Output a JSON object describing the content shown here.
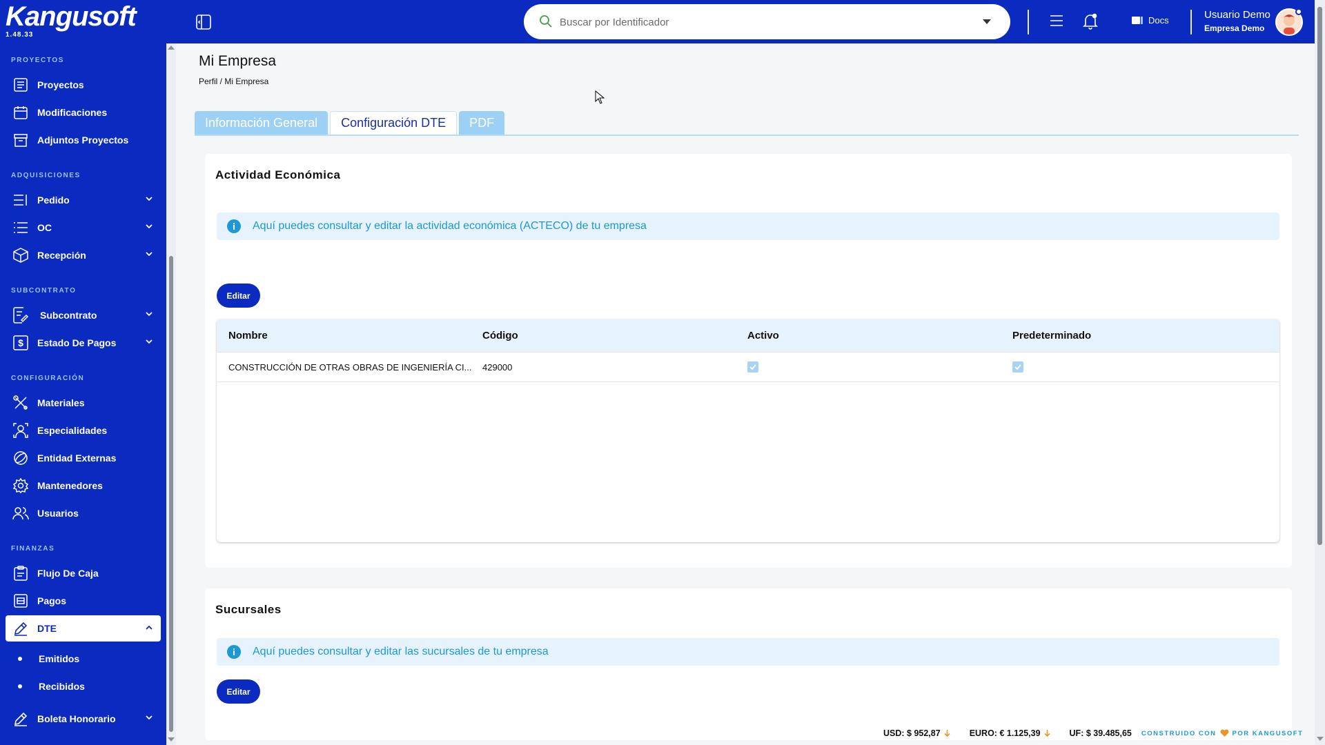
{
  "brand": {
    "name": "Kangusoft",
    "version": "1.48.33"
  },
  "header": {
    "search_placeholder": "Buscar por Identificador",
    "docs_label": "Docs",
    "user_name": "Usuario Demo",
    "company": "Empresa Demo"
  },
  "sidebar": {
    "sections": {
      "proyectos": "PROYECTOS",
      "adquisiciones": "ADQUISICIONES",
      "subcontrato": "SUBCONTRATO",
      "configuracion": "CONFIGURACIÓN",
      "finanzas": "FINANZAS"
    },
    "items": {
      "proyectos": "Proyectos",
      "modificaciones": "Modificaciones",
      "adjuntos": "Adjuntos Proyectos",
      "pedido": "Pedido",
      "oc": "OC",
      "recepcion": "Recepción",
      "subcontrato": "Subcontrato",
      "estado_pagos": "Estado De Pagos",
      "materiales": "Materiales",
      "especialidades": "Especialidades",
      "entidad_externas": "Entidad Externas",
      "mantenedores": "Mantenedores",
      "usuarios": "Usuarios",
      "flujo_caja": "Flujo De Caja",
      "pagos": "Pagos",
      "dte": "DTE",
      "emitidos": "Emitidos",
      "recibidos": "Recibidos",
      "boleta": "Boleta Honorario"
    }
  },
  "page": {
    "title": "Mi Empresa",
    "breadcrumb": "Perfil / Mi Empresa",
    "tabs": [
      "Información General",
      "Configuración DTE",
      "PDF"
    ],
    "active_tab": "Configuración DTE"
  },
  "actividad": {
    "title": "Actividad Económica",
    "info": "Aquí puedes consultar y editar la actividad económica (ACTECO) de tu empresa",
    "edit_label": "Editar",
    "columns": [
      "Nombre",
      "Código",
      "Activo",
      "Predeterminado"
    ],
    "rows": [
      {
        "nombre": "CONSTRUCCIÓN DE OTRAS OBRAS DE INGENIERÍA CI...",
        "codigo": "429000",
        "activo": true,
        "predeterminado": true
      }
    ]
  },
  "sucursales": {
    "title": "Sucursales",
    "info": "Aquí puedes consultar y editar las sucursales de tu empresa",
    "edit_label": "Editar"
  },
  "footer": {
    "usd": "USD: $ 952,87",
    "euro": "EURO: € 1.125,39",
    "uf": "UF: $ 39.485,65",
    "built_left": "CONSTRUIDO CON",
    "built_right": "POR KANGUSOFT"
  },
  "colors": {
    "primary": "#0a2ac0",
    "info": "#1b98d5",
    "tab_inactive": "#9dd0f5",
    "down_arrow": "#e8962b"
  }
}
